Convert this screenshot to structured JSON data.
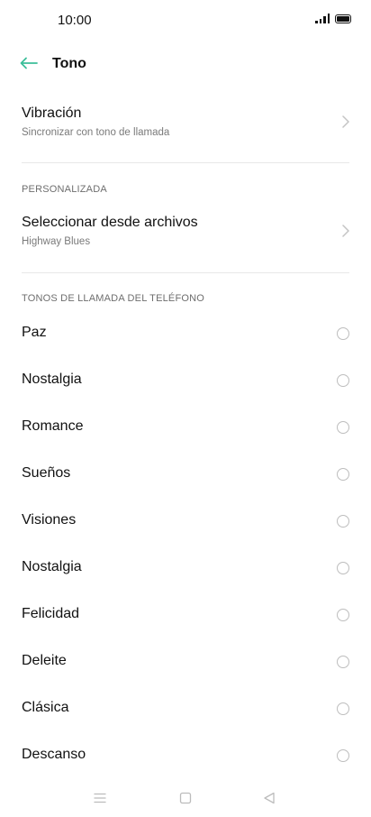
{
  "status": {
    "time": "10:00"
  },
  "header": {
    "title": "Tono",
    "back_icon": "arrow-left-icon",
    "accent": "#3cbf9a"
  },
  "vibration": {
    "title": "Vibración",
    "subtitle": "Sincronizar con tono de llamada"
  },
  "custom_section": {
    "header": "PERSONALIZADA",
    "item": {
      "title": "Seleccionar desde archivos",
      "subtitle": "Highway Blues"
    }
  },
  "ringtones_section": {
    "header": "TONOS DE LLAMADA DEL TELÉFONO",
    "items": [
      {
        "label": "Paz"
      },
      {
        "label": "Nostalgia"
      },
      {
        "label": "Romance"
      },
      {
        "label": "Sueños"
      },
      {
        "label": "Visiones"
      },
      {
        "label": "Nostalgia"
      },
      {
        "label": "Felicidad"
      },
      {
        "label": "Deleite"
      },
      {
        "label": "Clásica"
      },
      {
        "label": "Descanso"
      }
    ]
  },
  "nav_bar": {
    "menu_icon": "menu-icon",
    "home_icon": "home-icon",
    "back_icon": "back-triangle-icon"
  }
}
